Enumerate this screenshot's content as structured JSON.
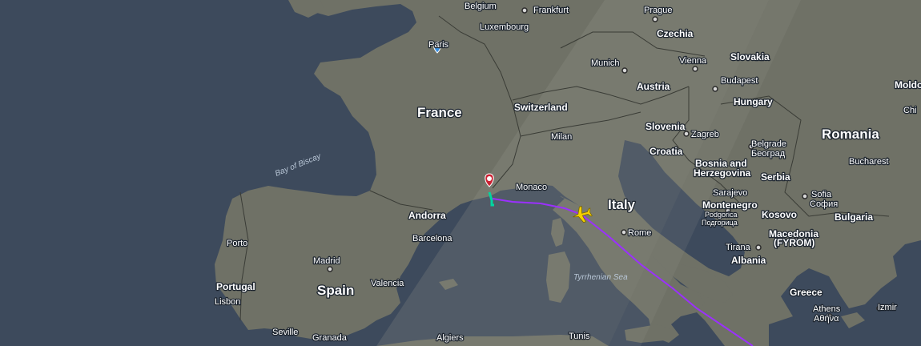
{
  "colors": {
    "sea": "#3d4a5c",
    "land": "#6f7166",
    "terminator_day": "#8a8a82",
    "flight_path": "#9b30ff",
    "flight_path_trail": "#00d6a0",
    "origin_marker": "#cc2233",
    "destination_marker": "#3b8fe0",
    "aircraft": "#f5d000"
  },
  "icons": {
    "aircraft": "aircraft-icon",
    "origin": "map-pin-icon",
    "destination": "map-pin-icon"
  },
  "labels": {
    "belgium": "Belgium",
    "frankfurt": "Frankfurt",
    "prague": "Prague",
    "czechia": "Czechia",
    "luxembourg": "Luxembourg",
    "paris": "Paris",
    "slovakia": "Slovakia",
    "munich": "Munich",
    "vienna": "Vienna",
    "budapest": "Budapest",
    "austria": "Austria",
    "hungary": "Hungary",
    "switzerland": "Switzerland",
    "france": "France",
    "slovenia": "Slovenia",
    "zagreb": "Zagreb",
    "milan": "Milan",
    "croatia": "Croatia",
    "romania": "Romania",
    "belgrade": "Belgrade",
    "belgrade_cyr": "Београд",
    "bay_of_biscay": "Bay of Biscay",
    "bosnia1": "Bosnia and",
    "bosnia2": "Herzegovina",
    "serbia": "Serbia",
    "bucharest": "Bucharest",
    "monaco": "Monaco",
    "sarajevo": "Sarajevo",
    "sofia": "Sofia",
    "sofia_cyr": "София",
    "andorra": "Andorra",
    "italy": "Italy",
    "montenegro": "Montenegro",
    "kosovo": "Kosovo",
    "bulgaria": "Bulgaria",
    "podgorica": "Podgorica",
    "podgorica_cyr": "Подгорица",
    "barcelona": "Barcelona",
    "rome": "Rome",
    "porto": "Porto",
    "macedonia": "Macedonia",
    "fyrom": "(FYROM)",
    "tirana": "Tirana",
    "madrid": "Madrid",
    "albania": "Albania",
    "portugal": "Portugal",
    "tyrrhenian": "Tyrrhenian Sea",
    "valencia": "Valencia",
    "spain": "Spain",
    "greece": "Greece",
    "lisbon": "Lisbon",
    "athens": "Athens",
    "athens_gr": "Αθήνα",
    "izmir": "Izmir",
    "seville": "Seville",
    "granada": "Granada",
    "algiers": "Algiers",
    "tunis": "Tunis",
    "moldova_partial": "Moldo",
    "chisinau_partial": "Chi"
  }
}
